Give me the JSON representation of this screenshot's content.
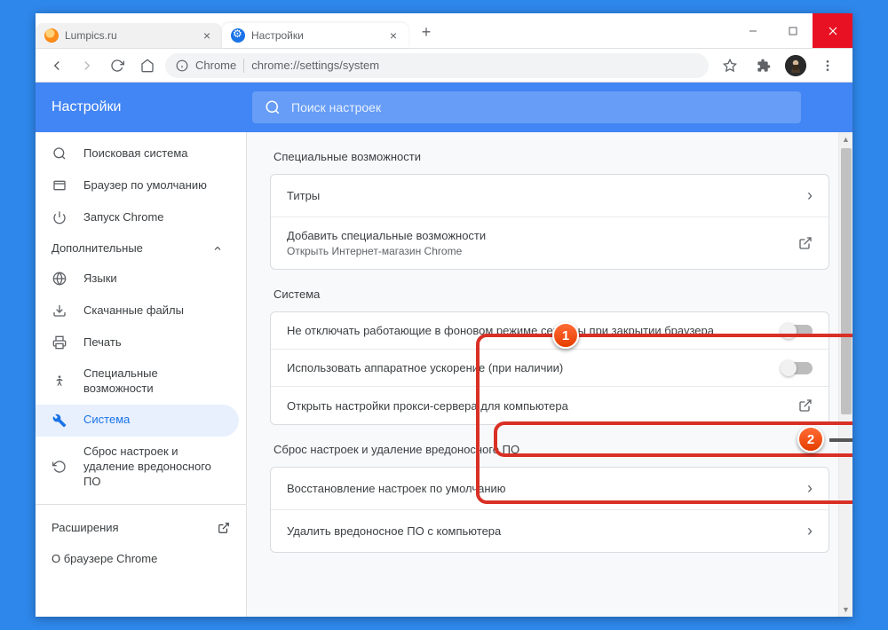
{
  "tabs": [
    {
      "title": "Lumpics.ru",
      "active": false
    },
    {
      "title": "Настройки",
      "active": true
    }
  ],
  "omnibox": {
    "origin_label": "Chrome",
    "url": "chrome://settings/system"
  },
  "settings_header": {
    "title": "Настройки",
    "search_placeholder": "Поиск настроек"
  },
  "sidebar": {
    "items": [
      {
        "icon": "search",
        "label": "Поисковая система"
      },
      {
        "icon": "browser",
        "label": "Браузер по умолчанию"
      },
      {
        "icon": "power",
        "label": "Запуск Chrome"
      }
    ],
    "section_label": "Дополнительные",
    "adv_items": [
      {
        "icon": "globe",
        "label": "Языки"
      },
      {
        "icon": "download",
        "label": "Скачанные файлы"
      },
      {
        "icon": "print",
        "label": "Печать"
      },
      {
        "icon": "a11y",
        "label": "Специальные возможности"
      },
      {
        "icon": "wrench",
        "label": "Система",
        "active": true
      },
      {
        "icon": "reset",
        "label": "Сброс настроек и удаление вредоносного ПО"
      }
    ],
    "links": [
      {
        "label": "Расширения",
        "ext": true
      },
      {
        "label": "О браузере Chrome",
        "ext": false
      }
    ]
  },
  "sections": {
    "a11y": {
      "title": "Специальные возможности",
      "rows": [
        {
          "label": "Титры",
          "action": "chev"
        },
        {
          "label": "Добавить специальные возможности",
          "sub": "Открыть Интернет-магазин Chrome",
          "action": "external"
        }
      ]
    },
    "system": {
      "title": "Система",
      "rows": [
        {
          "label": "Не отключать работающие в фоновом режиме сервисы при закрытии браузера",
          "action": "toggle",
          "on": false
        },
        {
          "label": "Использовать аппаратное ускорение (при наличии)",
          "action": "toggle",
          "on": false
        },
        {
          "label": "Открыть настройки прокси-сервера для компьютера",
          "action": "external"
        }
      ]
    },
    "reset": {
      "title": "Сброс настроек и удаление вредоносного ПО",
      "rows": [
        {
          "label": "Восстановление настроек по умолчанию",
          "action": "chev"
        },
        {
          "label": "Удалить вредоносное ПО с компьютера",
          "action": "chev"
        }
      ]
    }
  },
  "annotations": {
    "badge1": "1",
    "badge2": "2"
  }
}
